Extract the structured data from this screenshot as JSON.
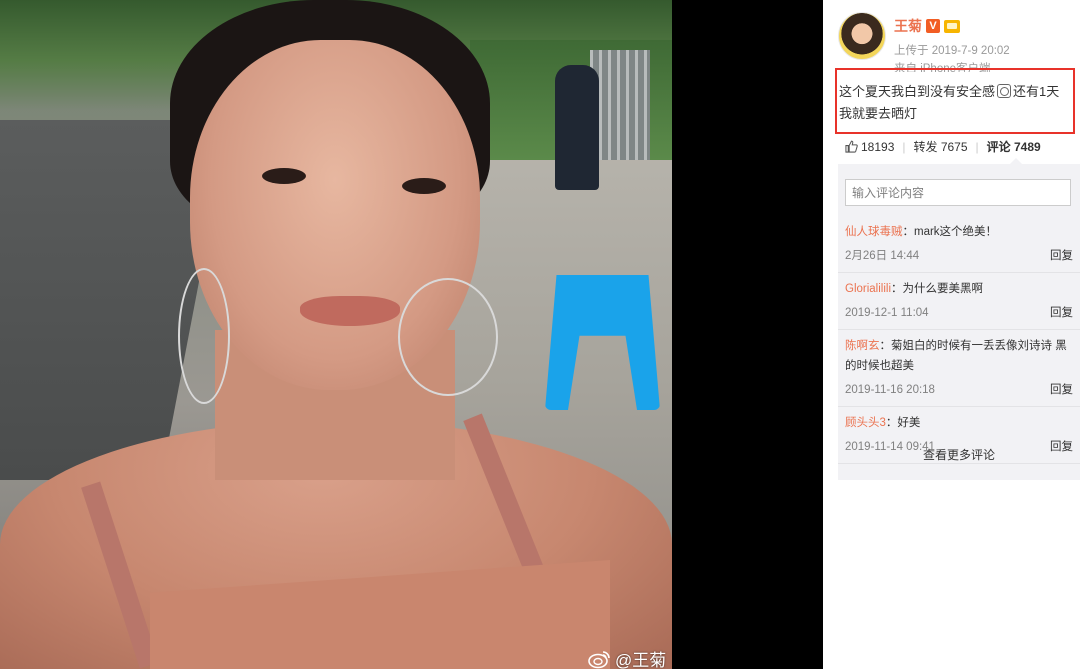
{
  "photo": {
    "watermark_text": "@王菊",
    "watermark_icon": "weibo-logo-icon"
  },
  "post": {
    "author_name": "王菊",
    "verified_badge": "V",
    "posted_time": "上传于 2019-7-9 20:02",
    "source": "来自 iPhone客户端",
    "text_part1": "这个夏天我白到没有安全感",
    "text_part2": "还有1天我就要去晒灯",
    "inline_icon": "camera-emoji-icon"
  },
  "actions": {
    "like_count": "18193",
    "repost_label": "转发 7675",
    "comment_label": "评论 7489"
  },
  "comment_input": {
    "placeholder": "输入评论内容"
  },
  "comments": [
    {
      "user": "仙人球毒贼",
      "text": "：mark这个绝美！",
      "time": "2月26日 14:44",
      "reply": "回复"
    },
    {
      "user": "Glorialilili",
      "text": "：为什么要美黑啊",
      "time": "2019-12-1 11:04",
      "reply": "回复"
    },
    {
      "user": "陈啊玄",
      "text": "：菊姐白的时候有一丢丢像刘诗诗 黑的时候也超美",
      "time": "2019-11-16 20:18",
      "reply": "回复"
    },
    {
      "user": "顾头头3",
      "text": "：好美",
      "time": "2019-11-14 09:41",
      "reply": "回复"
    }
  ],
  "more_comments_label": "查看更多评论",
  "colors": {
    "accent_orange": "#eb7350",
    "highlight_red": "#e8332a",
    "panel_bg": "#f2f2f5",
    "viewer_bg": "#000000"
  }
}
